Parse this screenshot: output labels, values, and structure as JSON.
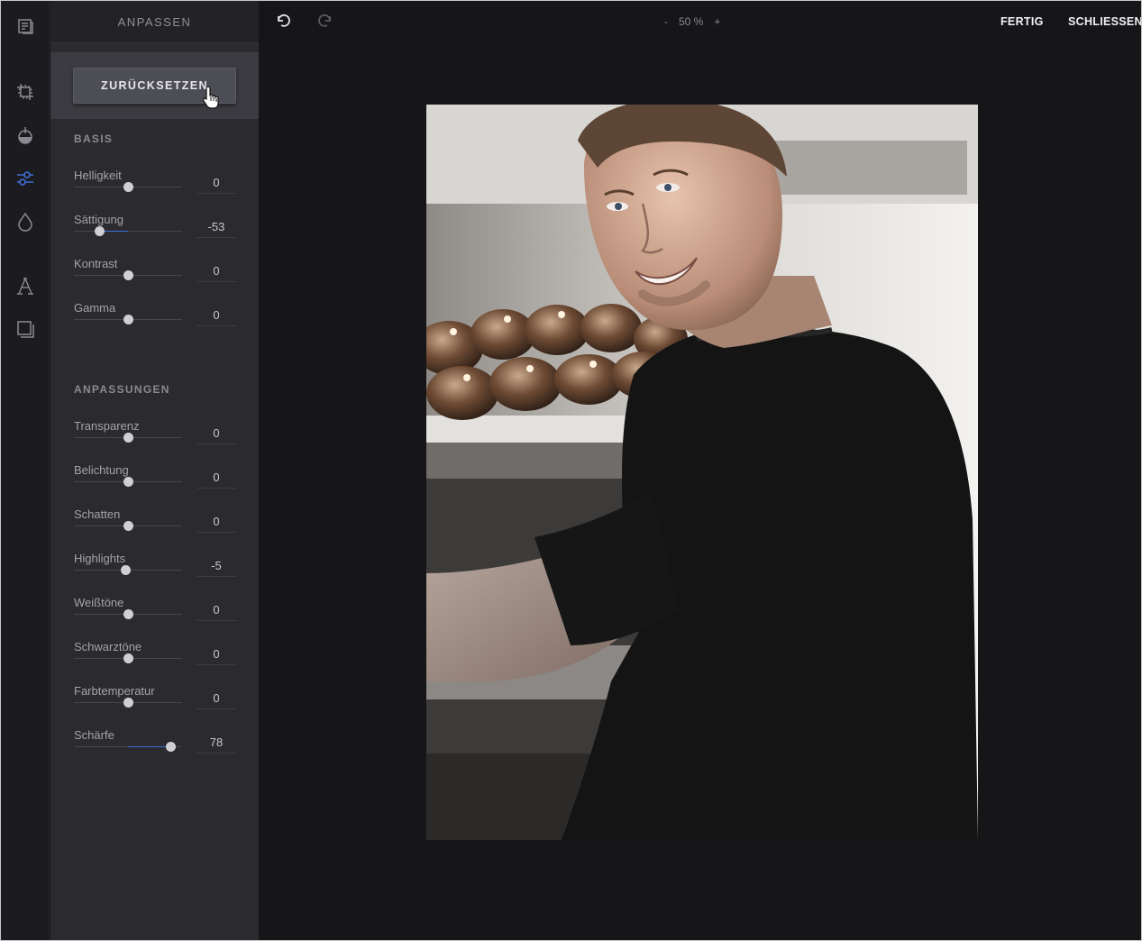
{
  "panel": {
    "title": "ANPASSEN",
    "reset_label": "ZURÜCKSETZEN",
    "basis_title": "BASIS",
    "basis": [
      {
        "label": "Helligkeit",
        "value": "0",
        "level": 0
      },
      {
        "label": "Sättigung",
        "value": "-53",
        "level": -53
      },
      {
        "label": "Kontrast",
        "value": "0",
        "level": 0
      },
      {
        "label": "Gamma",
        "value": "0",
        "level": 0
      }
    ],
    "adjust_title": "ANPASSUNGEN",
    "adjust": [
      {
        "label": "Transparenz",
        "value": "0",
        "level": 0
      },
      {
        "label": "Belichtung",
        "value": "0",
        "level": 0
      },
      {
        "label": "Schatten",
        "value": "0",
        "level": 0
      },
      {
        "label": "Highlights",
        "value": "-5",
        "level": -5
      },
      {
        "label": "Weißtöne",
        "value": "0",
        "level": 0
      },
      {
        "label": "Schwarztöne",
        "value": "0",
        "level": 0
      },
      {
        "label": "Farbtemperatur",
        "value": "0",
        "level": 0
      },
      {
        "label": "Schärfe",
        "value": "78",
        "level": 78
      }
    ]
  },
  "toolbar": {
    "zoom_minus": "-",
    "zoom_value": "50 %",
    "zoom_plus": "+",
    "done_label": "FERTIG",
    "close_label": "SCHLIESSEN"
  },
  "rail_icons": [
    "library-icon",
    "crop-icon",
    "filter-icon",
    "adjust-icon",
    "drop-icon",
    "text-icon",
    "frame-icon"
  ],
  "colors": {
    "accent": "#3f6fd8",
    "background": "#161619",
    "panel": "#2a2a2f"
  }
}
